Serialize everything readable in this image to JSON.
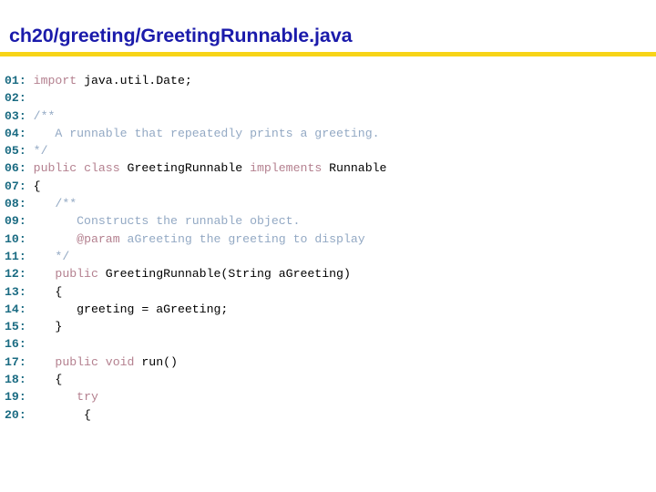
{
  "slide": {
    "title": "ch20/greeting/GreetingRunnable.java",
    "colors": {
      "title": "#1b1bab",
      "rule": "#f7d417",
      "line_number": "#1a6b82",
      "keyword": "#b4808f",
      "comment": "#93a9c4",
      "plain": "#000000",
      "background": "#ffffff"
    }
  },
  "code": {
    "language": "java",
    "first_line": 1,
    "last_line": 20,
    "lines": [
      {
        "number": "01:",
        "tokens": [
          {
            "text": " ",
            "type": "plain"
          },
          {
            "text": "import",
            "type": "keyword"
          },
          {
            "text": " java.util.Date;",
            "type": "plain"
          }
        ]
      },
      {
        "number": "02:",
        "tokens": []
      },
      {
        "number": "03:",
        "tokens": [
          {
            "text": " /**",
            "type": "comment"
          }
        ]
      },
      {
        "number": "04:",
        "tokens": [
          {
            "text": "    A runnable that repeatedly prints a greeting.",
            "type": "comment"
          }
        ]
      },
      {
        "number": "05:",
        "tokens": [
          {
            "text": " */",
            "type": "comment"
          }
        ]
      },
      {
        "number": "06:",
        "tokens": [
          {
            "text": " ",
            "type": "plain"
          },
          {
            "text": "public class",
            "type": "keyword"
          },
          {
            "text": " GreetingRunnable ",
            "type": "plain"
          },
          {
            "text": "implements",
            "type": "keyword"
          },
          {
            "text": " Runnable",
            "type": "plain"
          }
        ]
      },
      {
        "number": "07:",
        "tokens": [
          {
            "text": " {",
            "type": "plain"
          }
        ]
      },
      {
        "number": "08:",
        "tokens": [
          {
            "text": "    /**",
            "type": "comment"
          }
        ]
      },
      {
        "number": "09:",
        "tokens": [
          {
            "text": "       Constructs the runnable object.",
            "type": "comment"
          }
        ]
      },
      {
        "number": "10:",
        "tokens": [
          {
            "text": "       ",
            "type": "comment"
          },
          {
            "text": "@param",
            "type": "keyword"
          },
          {
            "text": " aGreeting the greeting to display",
            "type": "comment"
          }
        ]
      },
      {
        "number": "11:",
        "tokens": [
          {
            "text": "    */",
            "type": "comment"
          }
        ]
      },
      {
        "number": "12:",
        "tokens": [
          {
            "text": "    ",
            "type": "plain"
          },
          {
            "text": "public",
            "type": "keyword"
          },
          {
            "text": " GreetingRunnable(String aGreeting)",
            "type": "plain"
          }
        ]
      },
      {
        "number": "13:",
        "tokens": [
          {
            "text": "    {",
            "type": "plain"
          }
        ]
      },
      {
        "number": "14:",
        "tokens": [
          {
            "text": "       greeting = aGreeting;",
            "type": "plain"
          }
        ]
      },
      {
        "number": "15:",
        "tokens": [
          {
            "text": "    }",
            "type": "plain"
          }
        ]
      },
      {
        "number": "16:",
        "tokens": []
      },
      {
        "number": "17:",
        "tokens": [
          {
            "text": "    ",
            "type": "plain"
          },
          {
            "text": "public void",
            "type": "keyword"
          },
          {
            "text": " run()",
            "type": "plain"
          }
        ]
      },
      {
        "number": "18:",
        "tokens": [
          {
            "text": "    {",
            "type": "plain"
          }
        ]
      },
      {
        "number": "19:",
        "tokens": [
          {
            "text": "       ",
            "type": "plain"
          },
          {
            "text": "try",
            "type": "keyword"
          }
        ]
      },
      {
        "number": "20:",
        "tokens": [
          {
            "text": "        {",
            "type": "plain"
          }
        ]
      }
    ]
  }
}
